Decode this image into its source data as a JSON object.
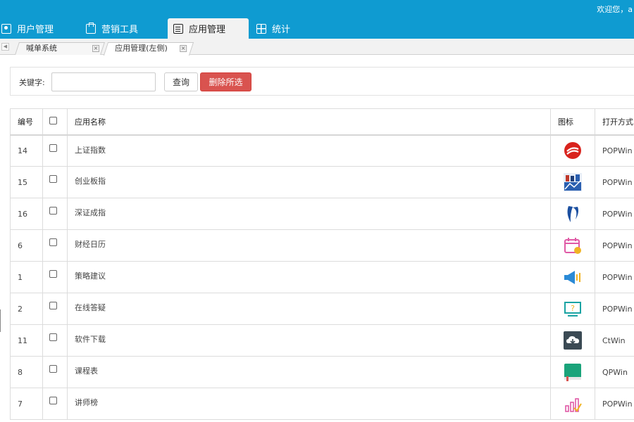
{
  "header": {
    "welcome": "欢迎您，a",
    "tabs": [
      {
        "label": "用户管理",
        "icon": "user-icon"
      },
      {
        "label": "营销工具",
        "icon": "toolbox-icon"
      },
      {
        "label": "应用管理",
        "icon": "document-icon"
      },
      {
        "label": "统计",
        "icon": "grid-chart-icon"
      }
    ],
    "active_tab": "应用管理"
  },
  "subtabs": [
    {
      "label": "喊单系统",
      "close": "×"
    },
    {
      "label": "应用管理(左侧)",
      "close": "×"
    }
  ],
  "nav_arrow": "◀",
  "search": {
    "label": "关键字:",
    "value": "",
    "placeholder": "",
    "query_button": "查询",
    "delete_button": "删除所选"
  },
  "table": {
    "columns": [
      "编号",
      "",
      "应用名称",
      "图标",
      "打开方式"
    ],
    "rows": [
      {
        "id": "14",
        "name": "上证指数",
        "icon": "shanghai-index-logo-icon",
        "open": "POPWin"
      },
      {
        "id": "15",
        "name": "创业板指",
        "icon": "chinext-logo-icon",
        "open": "POPWin"
      },
      {
        "id": "16",
        "name": "深证成指",
        "icon": "shenzhen-index-logo-icon",
        "open": "POPWin"
      },
      {
        "id": "6",
        "name": "财经日历",
        "icon": "calendar-icon",
        "open": "POPWin"
      },
      {
        "id": "1",
        "name": "策略建议",
        "icon": "megaphone-icon",
        "open": "POPWin"
      },
      {
        "id": "2",
        "name": "在线答疑",
        "icon": "question-monitor-icon",
        "open": "POPWin"
      },
      {
        "id": "11",
        "name": "软件下载",
        "icon": "cloud-download-icon",
        "open": "CtWin"
      },
      {
        "id": "8",
        "name": "课程表",
        "icon": "book-icon",
        "open": "QPWin"
      },
      {
        "id": "7",
        "name": "讲师榜",
        "icon": "ranking-chart-icon",
        "open": "POPWin"
      }
    ]
  },
  "colors": {
    "header_bg": "#0f9bd1",
    "delete_button_bg": "#d9534f",
    "tab_active_bg": "#f2f2f2"
  }
}
